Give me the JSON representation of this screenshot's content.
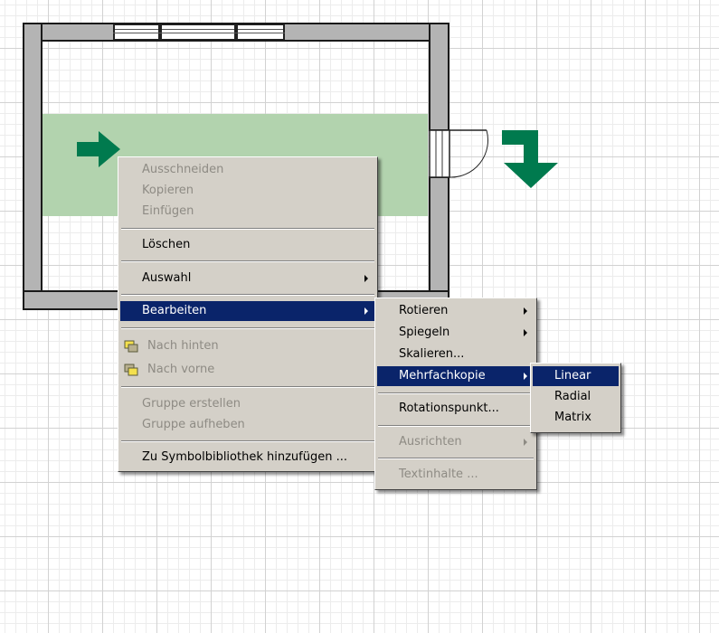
{
  "context_menu": {
    "items": [
      {
        "label": "Ausschneiden",
        "enabled": false
      },
      {
        "label": "Kopieren",
        "enabled": false
      },
      {
        "label": "Einfügen",
        "enabled": false
      },
      {
        "label": "Löschen",
        "enabled": true
      },
      {
        "label": "Auswahl",
        "enabled": true,
        "submenu": true
      },
      {
        "label": "Bearbeiten",
        "enabled": true,
        "submenu": true,
        "highlighted": true
      },
      {
        "label": "Nach hinten",
        "enabled": false,
        "icon": "send-backward-icon"
      },
      {
        "label": "Nach vorne",
        "enabled": false,
        "icon": "bring-forward-icon"
      },
      {
        "label": "Gruppe erstellen",
        "enabled": false
      },
      {
        "label": "Gruppe aufheben",
        "enabled": false
      },
      {
        "label": "Zu Symbolbibliothek hinzufügen ...",
        "enabled": true
      }
    ]
  },
  "edit_submenu": {
    "items": [
      {
        "label": "Rotieren",
        "enabled": true,
        "submenu": true
      },
      {
        "label": "Spiegeln",
        "enabled": true,
        "submenu": true
      },
      {
        "label": "Skalieren...",
        "enabled": true
      },
      {
        "label": "Mehrfachkopie",
        "enabled": true,
        "submenu": true,
        "highlighted": true
      },
      {
        "label": "Rotationspunkt...",
        "enabled": true
      },
      {
        "label": "Ausrichten",
        "enabled": false,
        "submenu": true
      },
      {
        "label": "Textinhalte ...",
        "enabled": false
      }
    ]
  },
  "copy_submenu": {
    "items": [
      {
        "label": "Linear",
        "highlighted": true
      },
      {
        "label": "Radial"
      },
      {
        "label": "Matrix"
      }
    ]
  },
  "colors": {
    "highlight": "#0a246a",
    "menu_bg": "#d4d0c8",
    "selection_fill": "#b2d3ae",
    "arrow_green": "#007a4e",
    "wall_fill": "#b4b4b4"
  },
  "icons": {
    "right_arrow": "arrow-right-icon",
    "down_turn_arrow": "arrow-turn-down-icon"
  }
}
